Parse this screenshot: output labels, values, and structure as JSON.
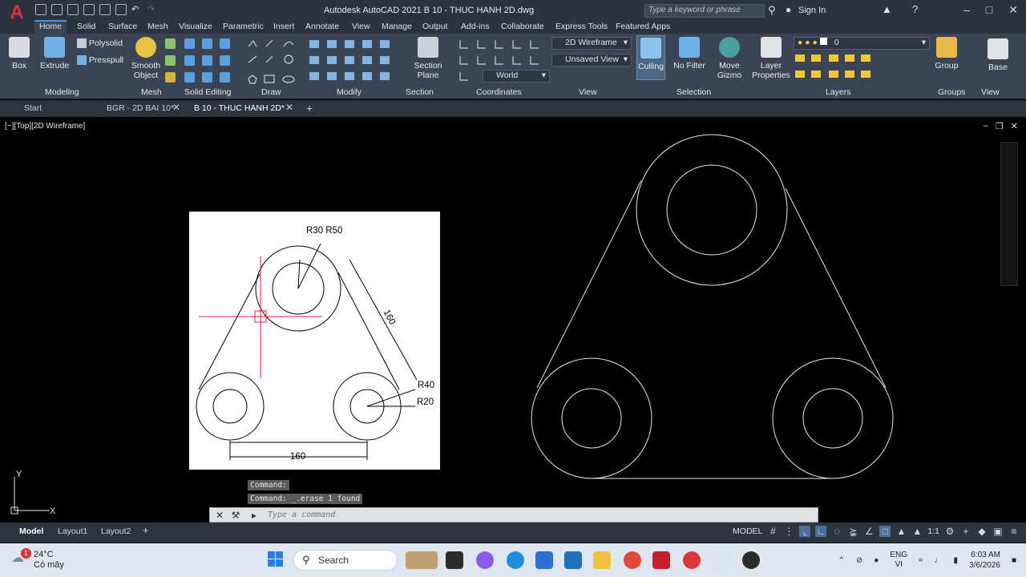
{
  "app": {
    "title": "Autodesk AutoCAD 2021    B 10 - THUC HANH 2D.dwg",
    "search_placeholder": "Type a keyword or phrase",
    "sign_in": "Sign In"
  },
  "ribbon_tabs": [
    "Home",
    "Solid",
    "Surface",
    "Mesh",
    "Visualize",
    "Parametric",
    "Insert",
    "Annotate",
    "View",
    "Manage",
    "Output",
    "Add-ins",
    "Collaborate",
    "Express Tools",
    "Featured Apps"
  ],
  "ribbon": {
    "box": "Box",
    "extrude": "Extrude",
    "polysolid": "Polysolid",
    "presspull": "Presspull",
    "smooth_object_1": "Smooth",
    "smooth_object_2": "Object",
    "section_plane_1": "Section",
    "section_plane_2": "Plane",
    "visual_style": "2D Wireframe",
    "view": "Unsaved View",
    "ucs": "World",
    "culling": "Culling",
    "no_filter": "No Filter",
    "move_gizmo_1": "Move",
    "move_gizmo_2": "Gizmo",
    "layer_properties_1": "Layer",
    "layer_properties_2": "Properties",
    "layer_current": "0",
    "group": "Group",
    "base": "Base",
    "panels": [
      "Modeling",
      "Mesh",
      "Solid Editing",
      "Draw",
      "Modify",
      "Section",
      "Coordinates",
      "View",
      "Selection",
      "Layers",
      "Groups",
      "View"
    ]
  },
  "doc_tabs": {
    "start": "Start",
    "tab1": "BGR - 2D BAI 10*",
    "tab2": "B 10 - THUC HANH 2D*"
  },
  "viewport": {
    "label": "[−][Top][2D Wireframe]"
  },
  "reference_drawing": {
    "label_r30_r50": "R30 R50",
    "label_160_slant": "160",
    "label_r40": "R40",
    "label_r20": "R20",
    "label_160_bottom": "160"
  },
  "command": {
    "history1": "Command:",
    "history2": "Command: _.erase 1 found",
    "placeholder": "Type a command"
  },
  "layout_tabs": [
    "Model",
    "Layout1",
    "Layout2"
  ],
  "status": {
    "model": "MODEL",
    "scale": "1:1"
  },
  "taskbar": {
    "temp": "24°C",
    "weather": "Có mây",
    "badge": "1",
    "search": "Search",
    "lang1": "ENG",
    "lang2": "VI",
    "time": "6:03 AM",
    "date": "3/6/2026"
  }
}
